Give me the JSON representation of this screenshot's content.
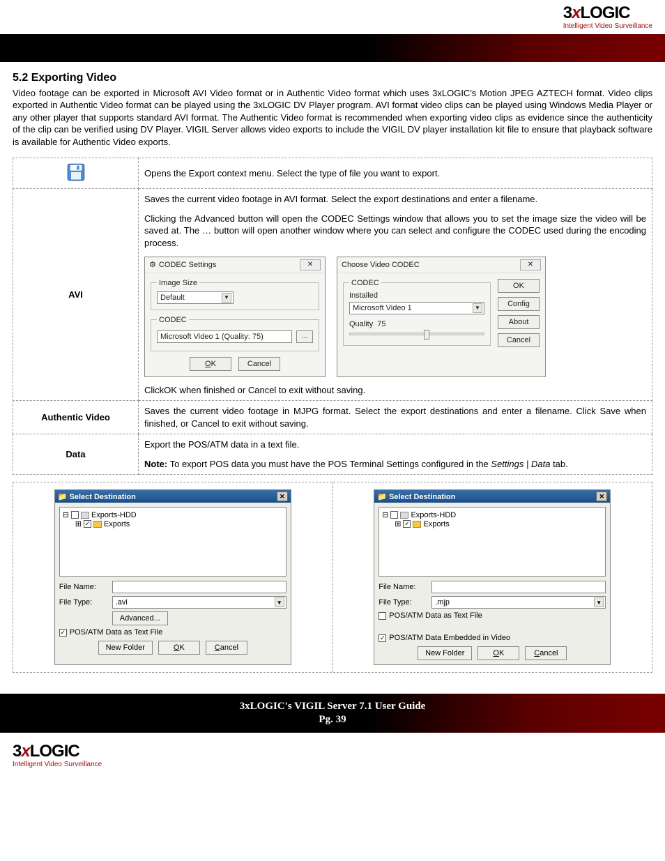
{
  "brand": {
    "name_parts": [
      "3",
      "x",
      "LOGIC"
    ],
    "tagline": "Intelligent Video Surveillance"
  },
  "section": {
    "number": "5.2",
    "title": "Exporting Video"
  },
  "intro": {
    "text": "Video footage can be exported in Microsoft AVI Video format or in Authentic Video format which uses 3xLOGIC's Motion JPEG AZTECH   format. Video clips exported in Authentic Video format can be played using the 3xLOGIC DV Player program. AVI format video clips can be played using Windows Media Player or any other player that supports standard AVI format.  The Authentic Video format is recommended when exporting video clips as evidence since the authenticity of the clip can be verified using DV Player. VIGIL Server allows video exports to include the VIGIL DV player installation kit file to ensure that playback software is available for Authentic Video exports."
  },
  "table": {
    "rows": [
      {
        "label_icon": true,
        "desc": "Opens the Export context menu. Select the type of file you want to export."
      },
      {
        "label": "AVI",
        "para1": "Saves the current video footage in AVI format. Select the export destinations and enter a filename.",
        "para2": "Clicking the Advanced button will open the CODEC Settings window that allows you to set the image size the video will be saved at.  The … button will open another window where you can select and configure the CODEC used during the encoding process.",
        "closing": "ClickOK when finished or Cancel to exit without saving."
      },
      {
        "label": "Authentic Video",
        "desc": "Saves the current video footage in MJPG format. Select the export destinations and enter a filename. Click Save when finished, or Cancel to exit without saving."
      },
      {
        "label": "Data",
        "desc": "Export the POS/ATM data in a text file.",
        "note": "Note: To export POS data you must have the POS Terminal Settings configured in the Settings | Data tab."
      }
    ]
  },
  "codec_dialog1": {
    "title": "CODEC Settings",
    "image_size_legend": "Image Size",
    "image_size_value": "Default",
    "codec_legend": "CODEC",
    "codec_value": "Microsoft Video 1 (Quality: 75)",
    "ok": "OK",
    "cancel": "Cancel"
  },
  "codec_dialog2": {
    "title": "Choose Video CODEC",
    "codec_legend": "CODEC",
    "installed_label": "Installed",
    "installed_value": "Microsoft Video 1",
    "quality_label": "Quality",
    "quality_value": "75",
    "ok": "OK",
    "config": "Config",
    "about": "About",
    "cancel": "Cancel"
  },
  "dest_dialog_left": {
    "title": "Select Destination",
    "tree_root": "Exports-HDD",
    "tree_child": "Exports",
    "file_name_label": "File Name:",
    "file_type_label": "File Type:",
    "file_type_value": ".avi",
    "advanced": "Advanced...",
    "chk_pos_text": "POS/ATM Data as Text File",
    "new_folder": "New Folder",
    "ok": "OK",
    "cancel": "Cancel"
  },
  "dest_dialog_right": {
    "title": "Select Destination",
    "tree_root": "Exports-HDD",
    "tree_child": "Exports",
    "file_name_label": "File Name:",
    "file_type_label": "File Type:",
    "file_type_value": ".mjp",
    "chk_pos_text": "POS/ATM Data as Text File",
    "chk_embed": "POS/ATM Data Embedded in Video",
    "new_folder": "New Folder",
    "ok": "OK",
    "cancel": "Cancel"
  },
  "footer": {
    "title": "3xLOGIC's VIGIL Server 7.1 User Guide",
    "page": "Pg. 39"
  }
}
